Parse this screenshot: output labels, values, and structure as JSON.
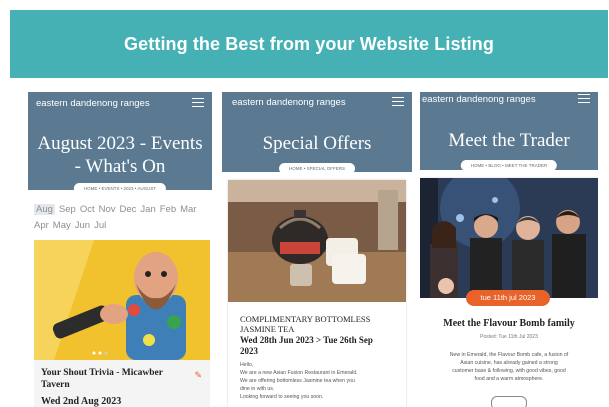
{
  "banner": {
    "title": "Getting the Best from your Website Listing"
  },
  "panels": [
    {
      "brand": "eastern dandenong ranges",
      "title_lines": [
        "August 2023 - Events",
        "- What's On"
      ],
      "breadcrumb": "HOME  •  EVENTS  •  2023  •  AUGUST",
      "months_row1": [
        "Aug",
        "Sep",
        "Oct",
        "Nov",
        "Dec",
        "Jan",
        "Feb",
        "Mar"
      ],
      "months_row2": [
        "Apr",
        "May",
        "Jun",
        "Jul"
      ],
      "selected_month": "Aug",
      "card_title_lines": [
        "Your Shout Trivia - Micawber",
        "Tavern"
      ],
      "card_date": "Wed 2nd Aug 2023"
    },
    {
      "brand": "eastern dandenong ranges",
      "title": "Special Offers",
      "breadcrumb": "HOME  •  SPECIAL OFFERS",
      "card_title_lines": [
        "COMPLIMENTARY BOTTOMLESS",
        "JASMINE TEA"
      ],
      "card_date_lines": [
        "Wed 28th Jun 2023  >  Tue 26th Sep",
        "2023"
      ],
      "body_lines": [
        "Hello,",
        "We are a new Asian Fusion Restaurant in Emerald.",
        "We are offering bottomless Jasmine tea when you",
        "dine in with us.",
        "Looking forward to seeing you soon."
      ]
    },
    {
      "brand": "eastern dandenong ranges",
      "title": "Meet the Trader",
      "breadcrumb": "HOME  •  BLOG  •  MEET THE TRADER",
      "date_badge": "tue 11th jul 2023",
      "card_title": "Meet the Flavour Bomb family",
      "posted": "Posted: Tue 11th Jul 2023",
      "body_lines": [
        "New in Emerald, the Flavour Bomb cafe, a fusion of",
        "Asian cuisine, has already gained a strong",
        "customer base & following, with good vibes, good",
        "food and a warm atmosphere."
      ]
    }
  ],
  "colors": {
    "banner": "#46b1b5",
    "header": "#5b7a91",
    "badge": "#e8622a",
    "event_image_bg": "#f2c12e"
  }
}
